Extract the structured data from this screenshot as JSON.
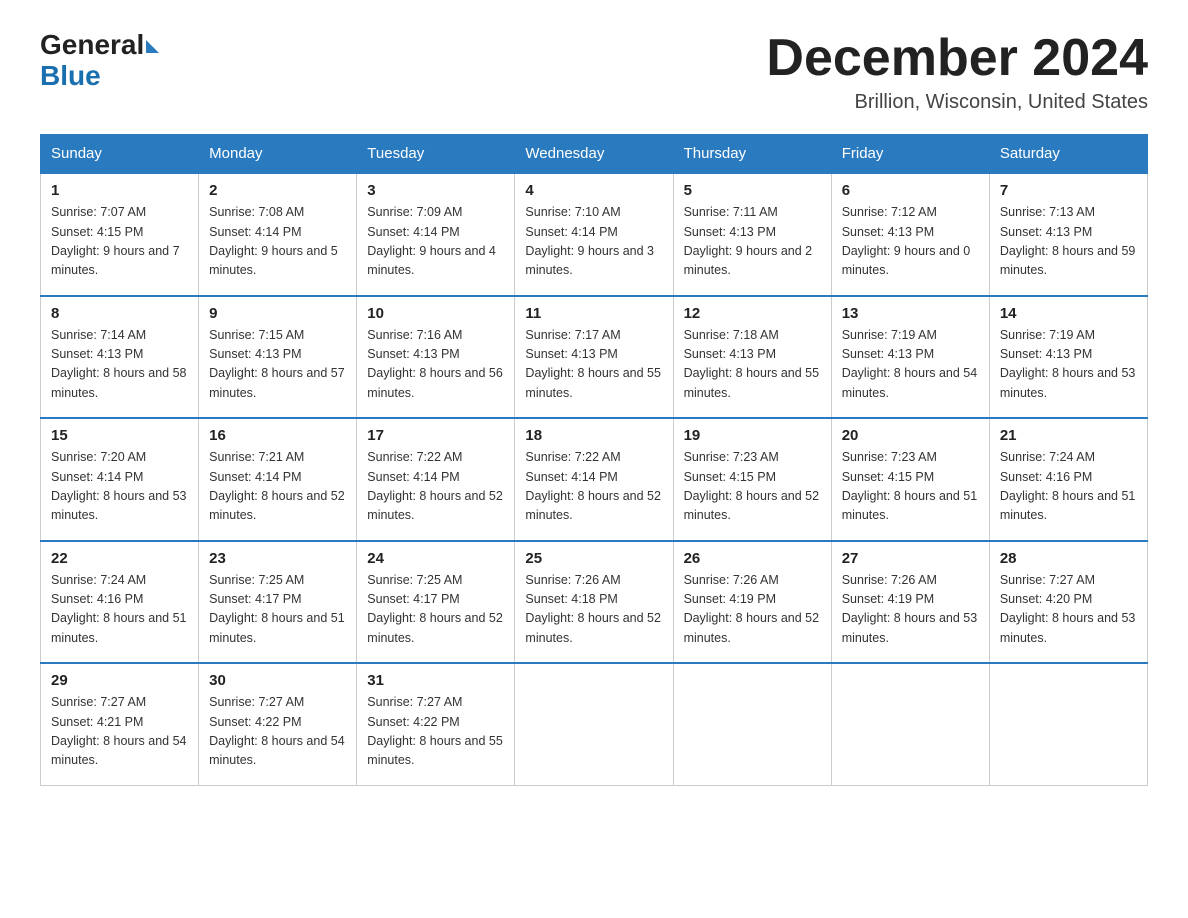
{
  "header": {
    "logo_general": "General",
    "logo_blue": "Blue",
    "month_title": "December 2024",
    "location": "Brillion, Wisconsin, United States"
  },
  "weekdays": [
    "Sunday",
    "Monday",
    "Tuesday",
    "Wednesday",
    "Thursday",
    "Friday",
    "Saturday"
  ],
  "weeks": [
    [
      {
        "day": "1",
        "sunrise": "Sunrise: 7:07 AM",
        "sunset": "Sunset: 4:15 PM",
        "daylight": "Daylight: 9 hours and 7 minutes."
      },
      {
        "day": "2",
        "sunrise": "Sunrise: 7:08 AM",
        "sunset": "Sunset: 4:14 PM",
        "daylight": "Daylight: 9 hours and 5 minutes."
      },
      {
        "day": "3",
        "sunrise": "Sunrise: 7:09 AM",
        "sunset": "Sunset: 4:14 PM",
        "daylight": "Daylight: 9 hours and 4 minutes."
      },
      {
        "day": "4",
        "sunrise": "Sunrise: 7:10 AM",
        "sunset": "Sunset: 4:14 PM",
        "daylight": "Daylight: 9 hours and 3 minutes."
      },
      {
        "day": "5",
        "sunrise": "Sunrise: 7:11 AM",
        "sunset": "Sunset: 4:13 PM",
        "daylight": "Daylight: 9 hours and 2 minutes."
      },
      {
        "day": "6",
        "sunrise": "Sunrise: 7:12 AM",
        "sunset": "Sunset: 4:13 PM",
        "daylight": "Daylight: 9 hours and 0 minutes."
      },
      {
        "day": "7",
        "sunrise": "Sunrise: 7:13 AM",
        "sunset": "Sunset: 4:13 PM",
        "daylight": "Daylight: 8 hours and 59 minutes."
      }
    ],
    [
      {
        "day": "8",
        "sunrise": "Sunrise: 7:14 AM",
        "sunset": "Sunset: 4:13 PM",
        "daylight": "Daylight: 8 hours and 58 minutes."
      },
      {
        "day": "9",
        "sunrise": "Sunrise: 7:15 AM",
        "sunset": "Sunset: 4:13 PM",
        "daylight": "Daylight: 8 hours and 57 minutes."
      },
      {
        "day": "10",
        "sunrise": "Sunrise: 7:16 AM",
        "sunset": "Sunset: 4:13 PM",
        "daylight": "Daylight: 8 hours and 56 minutes."
      },
      {
        "day": "11",
        "sunrise": "Sunrise: 7:17 AM",
        "sunset": "Sunset: 4:13 PM",
        "daylight": "Daylight: 8 hours and 55 minutes."
      },
      {
        "day": "12",
        "sunrise": "Sunrise: 7:18 AM",
        "sunset": "Sunset: 4:13 PM",
        "daylight": "Daylight: 8 hours and 55 minutes."
      },
      {
        "day": "13",
        "sunrise": "Sunrise: 7:19 AM",
        "sunset": "Sunset: 4:13 PM",
        "daylight": "Daylight: 8 hours and 54 minutes."
      },
      {
        "day": "14",
        "sunrise": "Sunrise: 7:19 AM",
        "sunset": "Sunset: 4:13 PM",
        "daylight": "Daylight: 8 hours and 53 minutes."
      }
    ],
    [
      {
        "day": "15",
        "sunrise": "Sunrise: 7:20 AM",
        "sunset": "Sunset: 4:14 PM",
        "daylight": "Daylight: 8 hours and 53 minutes."
      },
      {
        "day": "16",
        "sunrise": "Sunrise: 7:21 AM",
        "sunset": "Sunset: 4:14 PM",
        "daylight": "Daylight: 8 hours and 52 minutes."
      },
      {
        "day": "17",
        "sunrise": "Sunrise: 7:22 AM",
        "sunset": "Sunset: 4:14 PM",
        "daylight": "Daylight: 8 hours and 52 minutes."
      },
      {
        "day": "18",
        "sunrise": "Sunrise: 7:22 AM",
        "sunset": "Sunset: 4:14 PM",
        "daylight": "Daylight: 8 hours and 52 minutes."
      },
      {
        "day": "19",
        "sunrise": "Sunrise: 7:23 AM",
        "sunset": "Sunset: 4:15 PM",
        "daylight": "Daylight: 8 hours and 52 minutes."
      },
      {
        "day": "20",
        "sunrise": "Sunrise: 7:23 AM",
        "sunset": "Sunset: 4:15 PM",
        "daylight": "Daylight: 8 hours and 51 minutes."
      },
      {
        "day": "21",
        "sunrise": "Sunrise: 7:24 AM",
        "sunset": "Sunset: 4:16 PM",
        "daylight": "Daylight: 8 hours and 51 minutes."
      }
    ],
    [
      {
        "day": "22",
        "sunrise": "Sunrise: 7:24 AM",
        "sunset": "Sunset: 4:16 PM",
        "daylight": "Daylight: 8 hours and 51 minutes."
      },
      {
        "day": "23",
        "sunrise": "Sunrise: 7:25 AM",
        "sunset": "Sunset: 4:17 PM",
        "daylight": "Daylight: 8 hours and 51 minutes."
      },
      {
        "day": "24",
        "sunrise": "Sunrise: 7:25 AM",
        "sunset": "Sunset: 4:17 PM",
        "daylight": "Daylight: 8 hours and 52 minutes."
      },
      {
        "day": "25",
        "sunrise": "Sunrise: 7:26 AM",
        "sunset": "Sunset: 4:18 PM",
        "daylight": "Daylight: 8 hours and 52 minutes."
      },
      {
        "day": "26",
        "sunrise": "Sunrise: 7:26 AM",
        "sunset": "Sunset: 4:19 PM",
        "daylight": "Daylight: 8 hours and 52 minutes."
      },
      {
        "day": "27",
        "sunrise": "Sunrise: 7:26 AM",
        "sunset": "Sunset: 4:19 PM",
        "daylight": "Daylight: 8 hours and 53 minutes."
      },
      {
        "day": "28",
        "sunrise": "Sunrise: 7:27 AM",
        "sunset": "Sunset: 4:20 PM",
        "daylight": "Daylight: 8 hours and 53 minutes."
      }
    ],
    [
      {
        "day": "29",
        "sunrise": "Sunrise: 7:27 AM",
        "sunset": "Sunset: 4:21 PM",
        "daylight": "Daylight: 8 hours and 54 minutes."
      },
      {
        "day": "30",
        "sunrise": "Sunrise: 7:27 AM",
        "sunset": "Sunset: 4:22 PM",
        "daylight": "Daylight: 8 hours and 54 minutes."
      },
      {
        "day": "31",
        "sunrise": "Sunrise: 7:27 AM",
        "sunset": "Sunset: 4:22 PM",
        "daylight": "Daylight: 8 hours and 55 minutes."
      },
      null,
      null,
      null,
      null
    ]
  ]
}
